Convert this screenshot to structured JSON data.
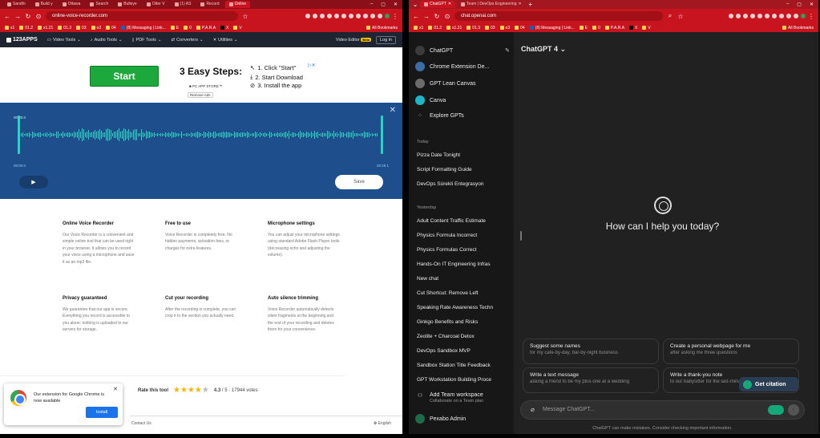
{
  "left_window": {
    "tabs": [
      "Sandhi",
      "Build y",
      "Ottawa",
      "Search",
      "Bulleye",
      "Otter V",
      "(1) AS",
      "Record",
      "Online"
    ],
    "url": "online-voice-recorder.com",
    "bookmarks": [
      "x1",
      "01.2",
      "x1.21",
      "01.3",
      "03",
      "o3",
      "04",
      "(8) Messaging | Link...",
      "E",
      "0",
      "P.A.R.A",
      "X",
      "V"
    ],
    "bookmarks_all": "All Bookmarks",
    "site": {
      "logo": "123APPS",
      "menu": [
        "Video Tools",
        "Audio Tools",
        "PDF Tools",
        "Converters",
        "Utilities"
      ],
      "video_editor": "Video Editor",
      "beta": "Beta",
      "login": "Log in"
    },
    "ad": {
      "start": "Start",
      "title": "3 Easy Steps:",
      "steps": [
        "1. Click \"Start\"",
        "2. Start Download",
        "3.  Install the app"
      ],
      "pcapp": "PC APP STORE™",
      "remove_ads": "Remove Ads",
      "adchoices": "▷✕"
    },
    "editor": {
      "time_top": "00:00.0",
      "time_left": "00:00.0",
      "time_right": "00:29.1",
      "play": "▶",
      "save": "Save",
      "close": "✕"
    },
    "features": [
      {
        "title": "Online Voice Recorder",
        "text": "Our Voice Recorder is a convenient and simple online tool that can be used right in your browser. It allows you to record your voice using a microphone and save it as an mp3 file."
      },
      {
        "title": "Free to use",
        "text": "Voice Recorder is completely free. No hidden payments, activation fees, or charges for extra features."
      },
      {
        "title": "Microphone settings",
        "text": "You can adjust your microphone settings using standard Adobe Flash Player tools (decreasing echo and adjusting the volume)."
      },
      {
        "title": "Privacy guaranteed",
        "text": "We guarantee that our app is secure. Everything you record is accessible to you alone: nothing is uploaded to our servers for storage."
      },
      {
        "title": "Cut your recording",
        "text": "After the recording is complete, you can crop it to the section you actually need."
      },
      {
        "title": "Auto silence trimming",
        "text": "Voice Recorder automatically detects silent fragments at the beginning and the end of your recording and deletes them for your convenience."
      }
    ],
    "chrome_popup": {
      "text": "Our extension for Google Chrome is now available",
      "install": "Install",
      "close": "✕"
    },
    "rating": {
      "label": "Rate this tool",
      "value": "4.3",
      "out_of": "/ 5",
      "votes": "17944 votes",
      "stars_filled": 4
    },
    "footer": {
      "contact": "Contact Us",
      "lang": "English"
    }
  },
  "right_window": {
    "tabs": [
      "ChatGPT",
      "Team | DevOps Engineering"
    ],
    "url": "chat.openai.com",
    "bookmarks": [
      "x1",
      "01.2",
      "x1.21",
      "01.3",
      "03",
      "o3",
      "04",
      "(8) Messaging | Link...",
      "E",
      "0",
      "P.A.R.A",
      "X",
      "V"
    ],
    "bookmarks_all": "All Bookmarks",
    "sidebar": {
      "top": [
        {
          "label": "ChatGPT",
          "color": "#3b3b3b"
        },
        {
          "label": "Chrome Extension De...",
          "color": "#3a6ea5"
        },
        {
          "label": "GPT Lean Canvas",
          "color": "#6b6b6b"
        },
        {
          "label": "Canva",
          "color": "#1fb5c7"
        },
        {
          "label": "Explore GPTs",
          "color": "#171717"
        }
      ],
      "today_label": "Today",
      "today": [
        "Pizza Date Tonight",
        "Script Formatting Guide",
        "DevOps Sürekli Entegrasyon"
      ],
      "yesterday_label": "Yesterday",
      "yesterday": [
        "Adult Content Traffic Estimate",
        "Physics Formula Incorrect",
        "Physics Formulas Correct",
        "Hands-On IT Engineering Infras",
        "New chat",
        "Cut Shortcut: Remove Left",
        "Speaking Rate Awareness Techn",
        "Ginkgo Benefits and Risks",
        "Zeolite + Charcoal Detox",
        "DevOps Sandbox MVP",
        "Sandbox Station Title Feedback",
        "GPT Workstation Building Proce"
      ],
      "team_title": "Add Team workspace",
      "team_sub": "Collaborate on a Team plan",
      "user": "Pexabo Admin"
    },
    "main": {
      "model": "ChatGPT 4",
      "greeting": "How can I help you today?",
      "suggestions": [
        {
          "title": "Suggest some names",
          "sub": "for my cafe-by-day, bar-by-night business"
        },
        {
          "title": "Create a personal webpage for me",
          "sub": "after asking me three questions"
        },
        {
          "title": "Write a text message",
          "sub": "asking a friend to be my plus-one at a wedding"
        },
        {
          "title": "Write a thank-you note",
          "sub": "to our babysitter for the last-minute help"
        }
      ],
      "citation": "Get citation",
      "placeholder": "Message ChatGPT...",
      "footnote": "ChatGPT can make mistakes. Consider checking important information."
    }
  }
}
